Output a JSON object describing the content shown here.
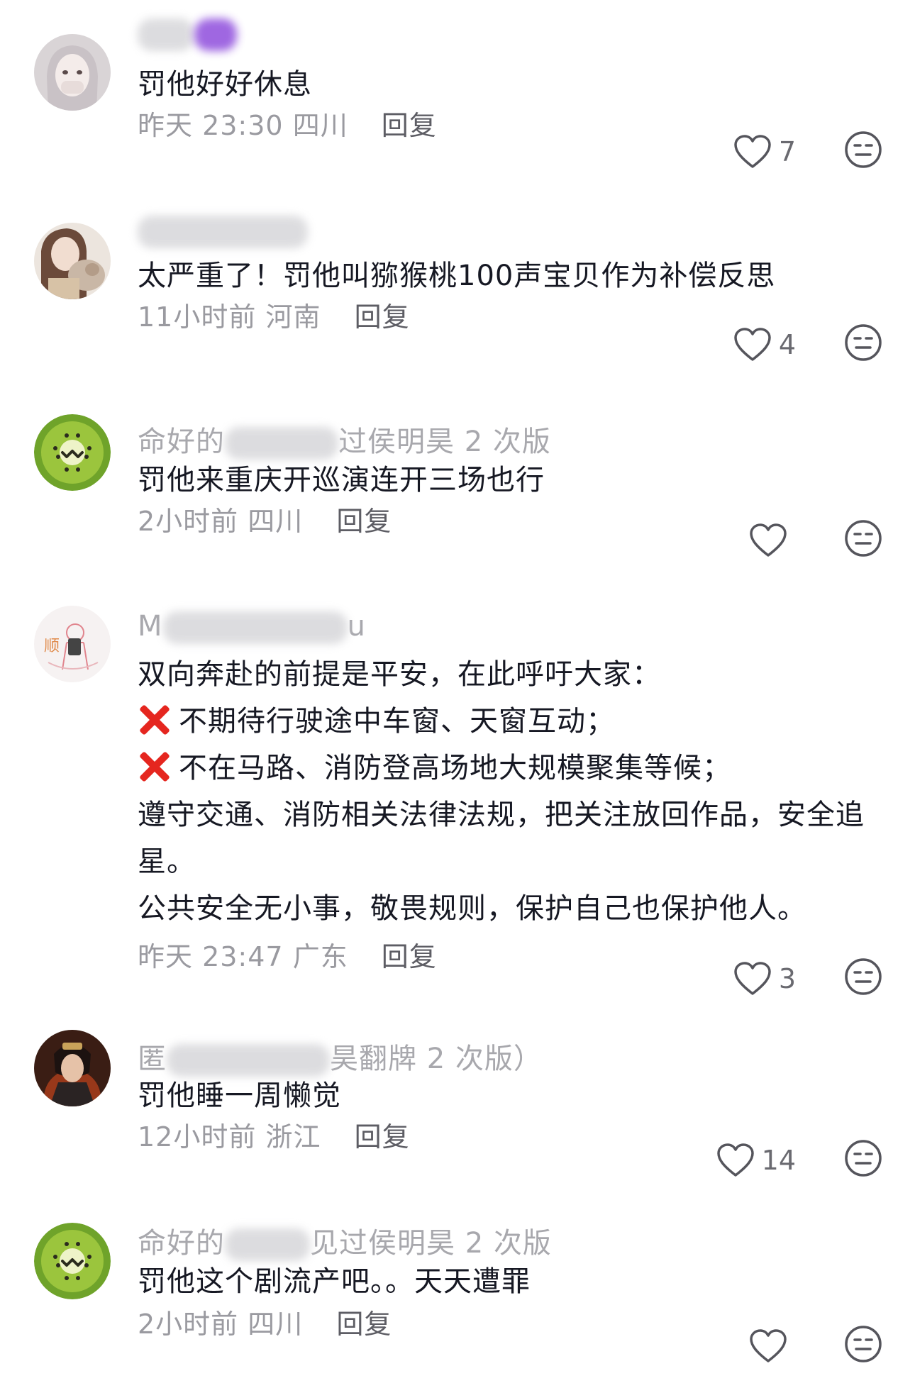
{
  "comments": [
    {
      "username_visible": "",
      "text": [
        "罚他好好休息"
      ],
      "time": "昨天 23:30",
      "location": "四川",
      "reply_label": "回复",
      "likes": "7",
      "avatar_icon": "girl-avatar-icon"
    },
    {
      "username_visible": "",
      "text": [
        "太严重了！罚他叫猕猴桃100声宝贝作为补偿反思"
      ],
      "time": "11小时前",
      "location": "河南",
      "reply_label": "回复",
      "likes": "4",
      "avatar_icon": "girl-with-cat-avatar-icon"
    },
    {
      "username_prefix": "命好的",
      "username_visible": "过侯明昊 2 次版",
      "text": [
        "罚他来重庆开巡演连开三场也行"
      ],
      "time": "2小时前",
      "location": "四川",
      "reply_label": "回复",
      "likes": "",
      "avatar_icon": "kiwi-avatar-icon"
    },
    {
      "username_prefix": "M",
      "username_visible": "u",
      "text": [
        "双向奔赴的前提是平安，在此呼吁大家：",
        "不期待行驶途中车窗、天窗互动；",
        "不在马路、消防登高场地大规模聚集等候；",
        "遵守交通、消防相关法律法规，把关注放回作品，安全追星。",
        "公共安全无小事，敬畏规则，保护自己也保护他人。"
      ],
      "time": "昨天 23:47",
      "location": "广东",
      "reply_label": "回复",
      "likes": "3",
      "avatar_icon": "drawing-avatar-icon"
    },
    {
      "username_prefix": "匿",
      "username_visible": "昊翻牌 2 次版）",
      "text": [
        "罚他睡一周懒觉"
      ],
      "time": "12小时前",
      "location": "浙江",
      "reply_label": "回复",
      "likes": "14",
      "avatar_icon": "costume-avatar-icon"
    },
    {
      "username_prefix": "命好的",
      "username_visible": "见过侯明昊 2 次版",
      "text": [
        "罚他这个剧流产吧。。天天遭罪"
      ],
      "time": "2小时前",
      "location": "四川",
      "reply_label": "回复",
      "likes": "",
      "avatar_icon": "kiwi-avatar-icon"
    }
  ],
  "colors": {
    "text": "#161823",
    "meta": "#9a9aa0",
    "reply": "#5d5d64",
    "cross": "#e5261f"
  }
}
